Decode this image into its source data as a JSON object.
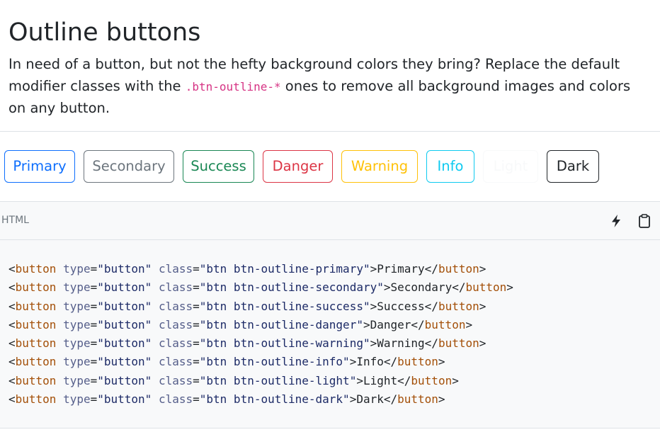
{
  "section": {
    "title": "Outline buttons",
    "lead_before": "In need of a button, but not the hefty background colors they bring? Replace the default modifier classes with the ",
    "lead_code": ".btn-outline-*",
    "lead_after": " ones to remove all background images and colors on any button."
  },
  "buttons": [
    {
      "label": "Primary",
      "color": "#0d6efd"
    },
    {
      "label": "Secondary",
      "color": "#6c757d"
    },
    {
      "label": "Success",
      "color": "#198754"
    },
    {
      "label": "Danger",
      "color": "#dc3545"
    },
    {
      "label": "Warning",
      "color": "#ffc107"
    },
    {
      "label": "Info",
      "color": "#0dcaf0"
    },
    {
      "label": "Light",
      "color": "#f8f9fa"
    },
    {
      "label": "Dark",
      "color": "#212529"
    }
  ],
  "code": {
    "language": "HTML",
    "icons": [
      "lightning-icon",
      "clipboard-icon"
    ],
    "lines": [
      {
        "cls": "btn btn-outline-primary",
        "text": "Primary"
      },
      {
        "cls": "btn btn-outline-secondary",
        "text": "Secondary"
      },
      {
        "cls": "btn btn-outline-success",
        "text": "Success"
      },
      {
        "cls": "btn btn-outline-danger",
        "text": "Danger"
      },
      {
        "cls": "btn btn-outline-warning",
        "text": "Warning"
      },
      {
        "cls": "btn btn-outline-info",
        "text": "Info"
      },
      {
        "cls": "btn btn-outline-light",
        "text": "Light"
      },
      {
        "cls": "btn btn-outline-dark",
        "text": "Dark"
      }
    ],
    "tokens": {
      "open_lt": "<",
      "tag": "button",
      "attr_type": "type",
      "eq": "=",
      "type_value": "\"button\"",
      "attr_class": "class",
      "quote": "\"",
      "gt": ">",
      "close_lt": "</"
    }
  }
}
